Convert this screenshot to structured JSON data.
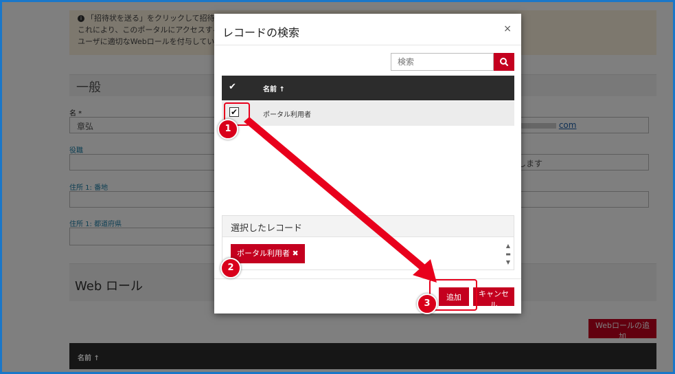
{
  "background": {
    "notice_lines": [
      "「招待状を送る」をクリックして招待状を送",
      "これにより、このポータルにアクセスするためのア",
      "ユーザに適切なWebロールを付与していることを"
    ],
    "general_title": "一般",
    "fields": {
      "name_label": "名 *",
      "name_value": "章弘",
      "title_label": "役職",
      "address_label": "住所 1: 番地",
      "prefecture_label": "住所 1: 都道府県",
      "email_suffix": "com",
      "right_field_text": "します"
    },
    "web_role_title": "Web ロール",
    "add_web_role_button": "Webロールの追加",
    "table_header_name": "名前"
  },
  "modal": {
    "title": "レコードの検索",
    "close": "×",
    "search_placeholder": "検索",
    "column_name": "名前",
    "rows": [
      {
        "name": "ポータル利用者",
        "checked": true
      }
    ],
    "selected_title": "選択したレコード",
    "selected_tags": [
      "ポータル利用者"
    ],
    "add_button": "追加",
    "cancel_button": "キャンセル"
  },
  "callouts": [
    "1",
    "2",
    "3"
  ],
  "colors": {
    "accent": "#c4001f",
    "annotation": "#e8001c",
    "frame": "#1a77c9"
  }
}
